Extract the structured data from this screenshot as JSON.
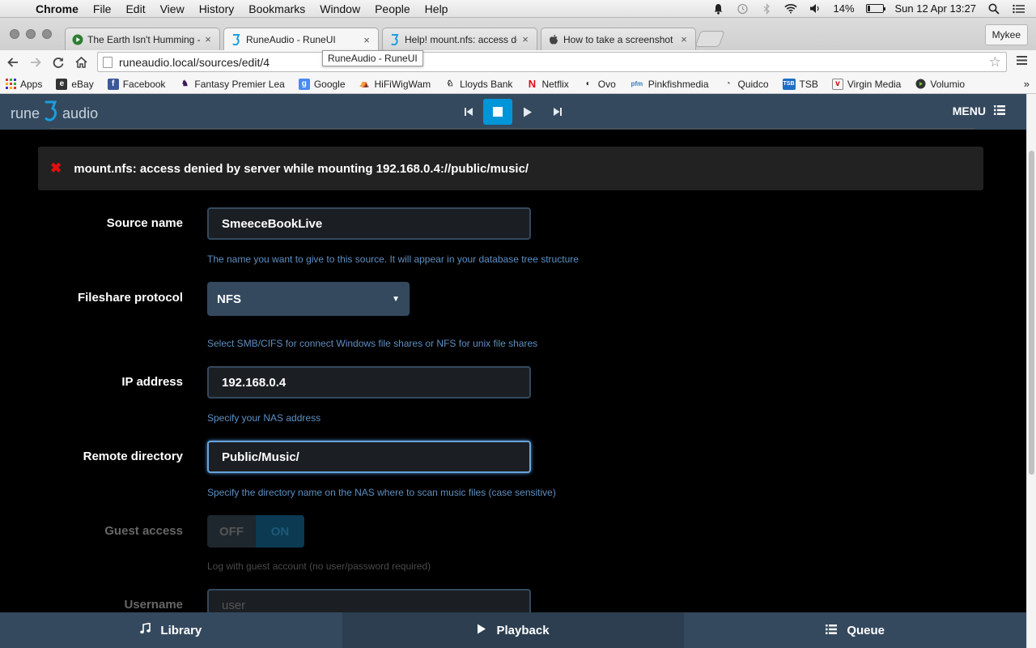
{
  "macbar": {
    "app": "Chrome",
    "menus": [
      "File",
      "Edit",
      "View",
      "History",
      "Bookmarks",
      "Window",
      "People",
      "Help"
    ],
    "battery": "14%",
    "battery_level": 0.14,
    "datetime": "Sun 12 Apr  13:27"
  },
  "tabs": [
    {
      "title": "The Earth Isn't Humming -",
      "icon": "play-circle-icon"
    },
    {
      "title": "RuneAudio - RuneUI",
      "icon": "runeaudio-icon"
    },
    {
      "title": "Help! mount.nfs: access de",
      "icon": "runeaudio-icon"
    },
    {
      "title": "How to take a screenshot o",
      "icon": "apple-icon"
    }
  ],
  "profile": "Mykee",
  "url": "runeaudio.local/sources/edit/4",
  "tooltip": "RuneAudio - RuneUI",
  "bookmarks": [
    {
      "label": "Apps",
      "icon": "apps-grid-icon"
    },
    {
      "label": "eBay",
      "icon": "ebay-icon"
    },
    {
      "label": "Facebook",
      "icon": "facebook-icon"
    },
    {
      "label": "Fantasy Premier Lea",
      "icon": "fpl-icon"
    },
    {
      "label": "Google",
      "icon": "google-icon"
    },
    {
      "label": "HiFiWigWam",
      "icon": "hifiwigwam-icon"
    },
    {
      "label": "Lloyds Bank",
      "icon": "lloyds-icon"
    },
    {
      "label": "Netflix",
      "icon": "netflix-icon"
    },
    {
      "label": "Ovo",
      "icon": "ovo-icon"
    },
    {
      "label": "Pinkfishmedia",
      "icon": "pfm-icon"
    },
    {
      "label": "Quidco",
      "icon": "quidco-icon"
    },
    {
      "label": "TSB",
      "icon": "tsb-icon"
    },
    {
      "label": "Virgin Media",
      "icon": "virgin-icon"
    },
    {
      "label": "Volumio",
      "icon": "volumio-icon"
    }
  ],
  "app": {
    "logo_left": "rune",
    "logo_right": "audio",
    "menu_label": "MENU",
    "error": "mount.nfs: access denied by server while mounting 192.168.0.4://public/music/",
    "form": {
      "source_name": {
        "label": "Source name",
        "value": "SmeeceBookLive",
        "help": "The name you want to give to this source. It will appear in your database tree structure"
      },
      "protocol": {
        "label": "Fileshare protocol",
        "value": "NFS",
        "help": "Select SMB/CIFS for connect Windows file shares or NFS for unix file shares"
      },
      "ip": {
        "label": "IP address",
        "value": "192.168.0.4",
        "help": "Specify your NAS address"
      },
      "remote_dir": {
        "label": "Remote directory",
        "value": "Public/Music/",
        "help": "Specify the directory name on the NAS where to scan music files (case sensitive)"
      },
      "guest": {
        "label": "Guest access",
        "off": "OFF",
        "on": "ON",
        "help": "Log with guest account (no user/password required)"
      },
      "username": {
        "label": "Username",
        "placeholder": "user"
      }
    },
    "bottom_tabs": [
      {
        "label": "Library",
        "icon": "music-note-icon"
      },
      {
        "label": "Playback",
        "icon": "play-icon"
      },
      {
        "label": "Queue",
        "icon": "list-icon"
      }
    ]
  }
}
